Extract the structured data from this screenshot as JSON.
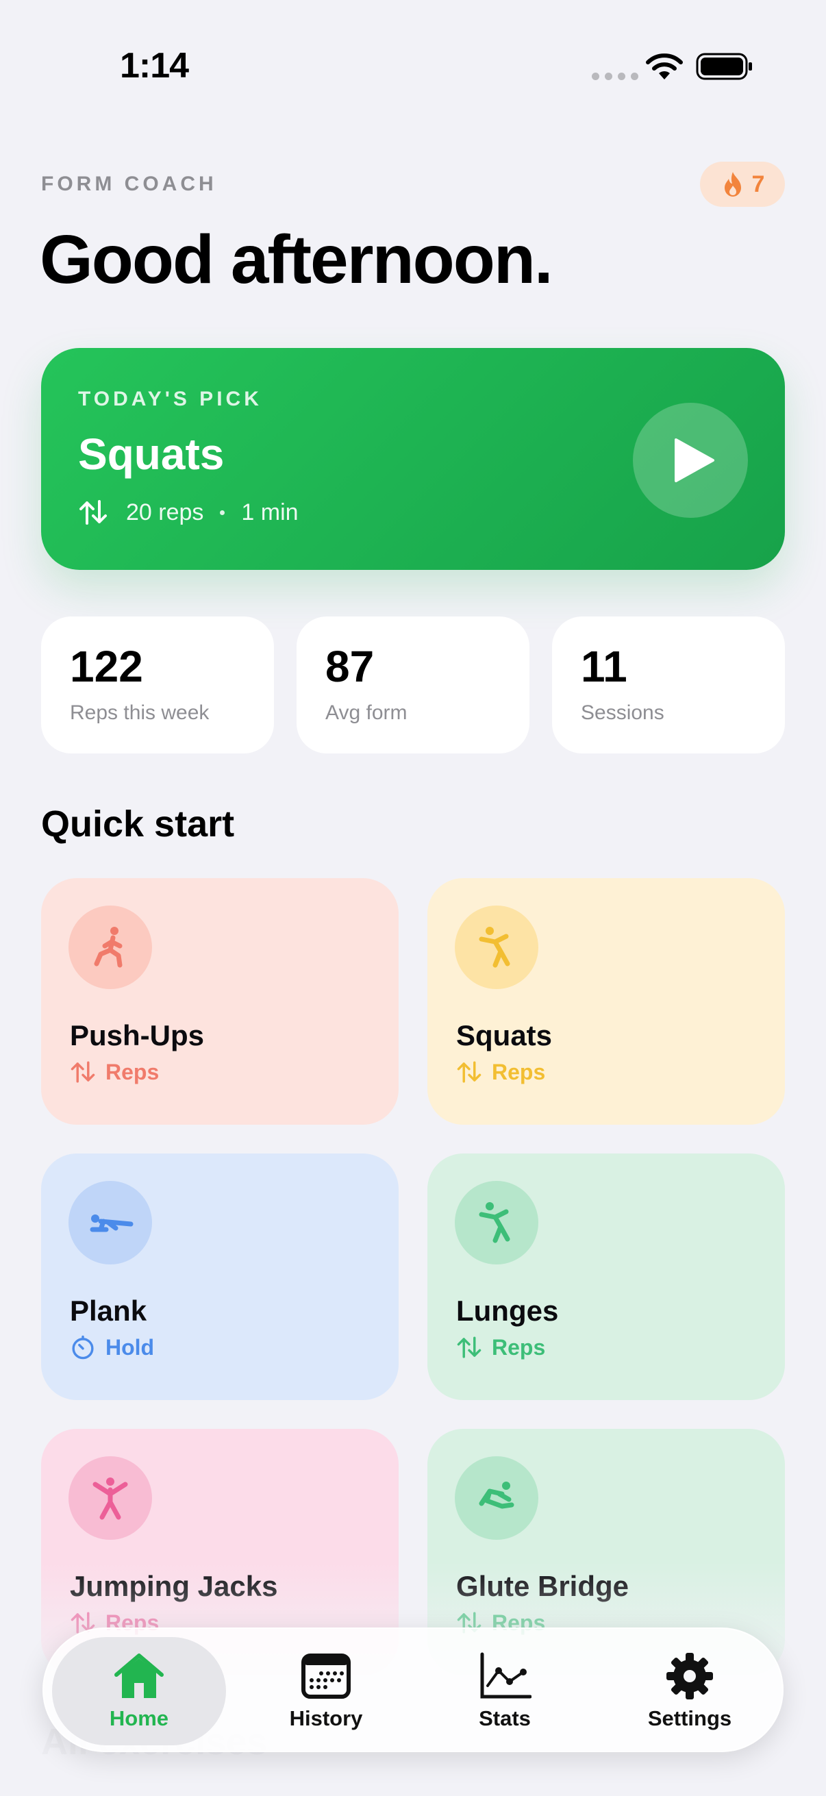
{
  "status_bar": {
    "time": "1:14"
  },
  "header": {
    "eyebrow": "FORM COACH",
    "greeting": "Good afternoon.",
    "streak": {
      "icon": "flame-icon",
      "count": "7"
    }
  },
  "todays_pick": {
    "eyebrow": "TODAY'S PICK",
    "title": "Squats",
    "reps": "20 reps",
    "duration": "1 min"
  },
  "stats": [
    {
      "value": "122",
      "label": "Reps this week"
    },
    {
      "value": "87",
      "label": "Avg form"
    },
    {
      "value": "11",
      "label": "Sessions"
    }
  ],
  "quick_start": {
    "title": "Quick start",
    "exercises": [
      {
        "name": "Push-Ups",
        "mode": "Reps",
        "icon": "lunge-figure-icon",
        "accent": "#F07B6B",
        "bg": "#FDE3DE",
        "icon_bg": "#FCCAC0"
      },
      {
        "name": "Squats",
        "mode": "Reps",
        "icon": "stretch-figure-icon",
        "accent": "#F2BE32",
        "bg": "#FEF1D5",
        "icon_bg": "#FDE3A5"
      },
      {
        "name": "Plank",
        "mode": "Hold",
        "icon": "plank-figure-icon",
        "accent": "#4B8BEA",
        "bg": "#DCE8FB",
        "icon_bg": "#BFD5F8"
      },
      {
        "name": "Lunges",
        "mode": "Reps",
        "icon": "stretch-figure-icon",
        "accent": "#3DBE78",
        "bg": "#D9F1E3",
        "icon_bg": "#B6E6CB"
      },
      {
        "name": "Jumping Jacks",
        "mode": "Reps",
        "icon": "jumping-jack-figure-icon",
        "accent": "#EC5F98",
        "bg": "#FCDCE9",
        "icon_bg": "#F8BCD3"
      },
      {
        "name": "Glute Bridge",
        "mode": "Reps",
        "icon": "bridge-figure-icon",
        "accent": "#3DBE78",
        "bg": "#D9F1E3",
        "icon_bg": "#B6E6CB"
      }
    ]
  },
  "all_exercises_title": "All exercises",
  "tab_bar": {
    "items": [
      {
        "label": "Home",
        "icon": "house-icon",
        "active": true
      },
      {
        "label": "History",
        "icon": "calendar-icon",
        "active": false
      },
      {
        "label": "Stats",
        "icon": "line-chart-icon",
        "active": false
      },
      {
        "label": "Settings",
        "icon": "gear-icon",
        "active": false
      }
    ]
  },
  "colors": {
    "accent_green": "#22B550",
    "background": "#F2F2F7",
    "streak_orange": "#F2843C"
  }
}
